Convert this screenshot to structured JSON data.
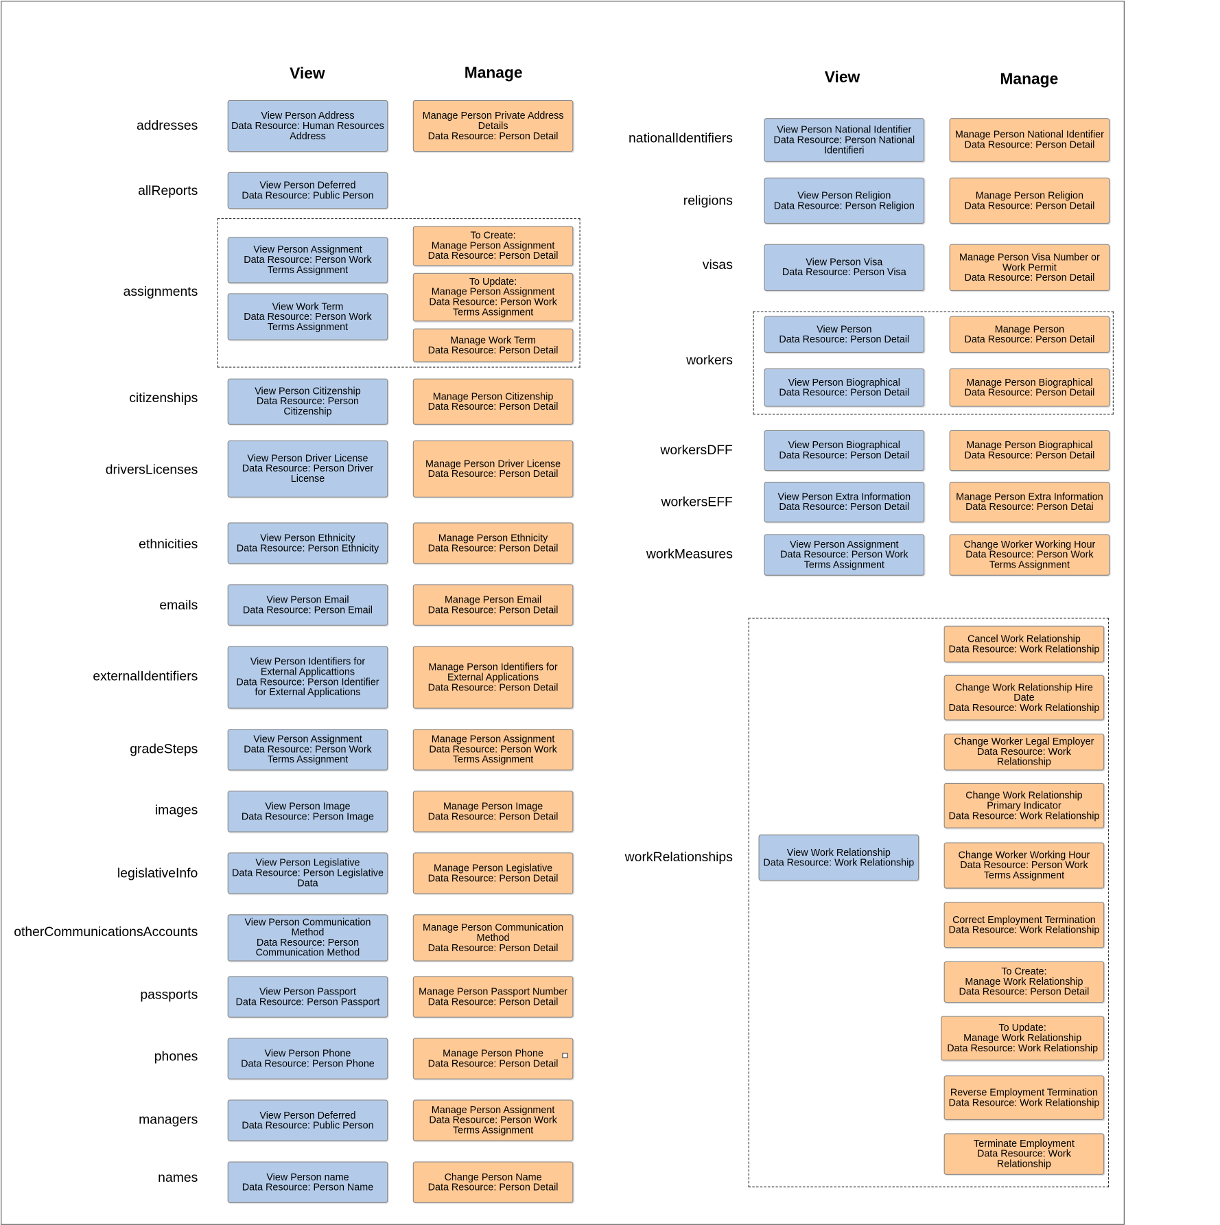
{
  "colors": {
    "view_box": "#b3cbe9",
    "manage_box": "#ffc995",
    "border": "#8a8a8a"
  },
  "left_headers": {
    "view": "View",
    "manage": "Manage"
  },
  "right_headers": {
    "view": "View",
    "manage": "Manage"
  },
  "left_rows": [
    {
      "label": "addresses",
      "view": [
        "View Person Address\nData Resource: Human Resources\nAddress"
      ],
      "manage": [
        "Manage Person Private Address\nDetails\nData Resource: Person Detail"
      ]
    },
    {
      "label": "allReports",
      "view": [
        "View Person Deferred\nData Resource: Public Person"
      ],
      "manage": []
    },
    {
      "label": "assignments",
      "view": [
        "View Person Assignment\nData Resource: Person Work\nTerms Assignment",
        "View Work Term\nData Resource: Person Work\nTerms Assignment"
      ],
      "manage": [
        "To Create:\nManage Person Assignment\nData Resource: Person Detail",
        "To Update:\nManage Person Assignment\nData Resource: Person Work\nTerms Assignment",
        "Manage Work Term\nData Resource: Person Detail"
      ]
    },
    {
      "label": "citizenships",
      "view": [
        "View Person Citizenship\nData Resource: Person\nCitizenship"
      ],
      "manage": [
        "Manage Person Citizenship\nData Resource: Person Detail"
      ]
    },
    {
      "label": "driversLicenses",
      "view": [
        "View Person Driver License\nData Resource: Person Driver\nLicense"
      ],
      "manage": [
        "Manage Person Driver License\nData Resource: Person Detail"
      ]
    },
    {
      "label": "ethnicities",
      "view": [
        "View Person Ethnicity\nData Resource: Person Ethnicity"
      ],
      "manage": [
        "Manage Person Ethnicity\nData Resource: Person Detail"
      ]
    },
    {
      "label": "emails",
      "view": [
        "View Person Email\nData Resource: Person Email"
      ],
      "manage": [
        "Manage Person Email\nData Resource: Person Detail"
      ]
    },
    {
      "label": "externalIdentifiers",
      "view": [
        "View Person Identifiers for\nExternal Applicattions\nData Resource: Person Identifier\nfor External Applications"
      ],
      "manage": [
        "Manage Person Identifiers for\nExternal Applications\nData Resource: Person Detail"
      ]
    },
    {
      "label": "gradeSteps",
      "view": [
        "View Person Assignment\nData Resource: Person Work\nTerms Assignment"
      ],
      "manage": [
        "Manage Person Assignment\nData Resource:  Person Work\nTerms Assignment"
      ]
    },
    {
      "label": "images",
      "view": [
        "View Person Image\nData Resource: Person Image"
      ],
      "manage": [
        "Manage Person Image\nData Resource: Person Detail"
      ]
    },
    {
      "label": "legislativeInfo",
      "view": [
        "View Person Legislative\nData Resource: Person Legislative\nData"
      ],
      "manage": [
        "Manage Person Legislative\nData Resource: Person Detail"
      ]
    },
    {
      "label": "otherCommunicationsAccounts",
      "view": [
        "View Person Communication\nMethod\nData Resource: Person\nCommunication Method"
      ],
      "manage": [
        "Manage Person Communication\nMethod\nData Resource: Person Detail"
      ]
    },
    {
      "label": "passports",
      "view": [
        "View Person Passport\nData Resource: Person Passport"
      ],
      "manage": [
        "Manage Person Passport Number\nData Resource: Person Detail"
      ]
    },
    {
      "label": "phones",
      "view": [
        "View Person Phone\nData Resource: Person Phone"
      ],
      "manage": [
        "Manage Person Phone\nData Resource: Person Detail"
      ]
    },
    {
      "label": "managers",
      "view": [
        "View Person Deferred\nData Resource: Public Person"
      ],
      "manage": [
        "Manage Person Assignment\nData Resource: Person Work\nTerms Assignment"
      ]
    },
    {
      "label": "names",
      "view": [
        "View Person name\nData Resource: Person Name"
      ],
      "manage": [
        "Change Person Name\nData Resource: Person Detail"
      ]
    }
  ],
  "right_rows": [
    {
      "label": "nationalIdentifiers",
      "view": [
        "View Person National Identifier\nData Resource: Person National\nIdentifieri"
      ],
      "manage": [
        "Manage Person National Identifier\nData Resource: Person Detail"
      ]
    },
    {
      "label": "religions",
      "view": [
        "View Person Religion\nData Resource: Person Religion"
      ],
      "manage": [
        "Manage Person Religion\nData Resource: Person Detail"
      ]
    },
    {
      "label": "visas",
      "view": [
        "View Person Visa\nData Resource: Person Visa"
      ],
      "manage": [
        "Manage Person Visa Number or\nWork Permit\nData Resource: Person Detail"
      ]
    },
    {
      "label": "workers",
      "view": [
        "View Person\nData Resource: Person Detail",
        "View Person Biographical\nData Resource: Person Detail"
      ],
      "manage": [
        "Manage Person\nData Resource: Person Detail",
        "Manage Person Biographical\nData Resource: Person Detail"
      ]
    },
    {
      "label": "workersDFF",
      "view": [
        "View Person Biographical\nData Resource: Person Detail"
      ],
      "manage": [
        "Manage Person Biographical\nData Resource: Person Detail"
      ]
    },
    {
      "label": "workersEFF",
      "view": [
        "View Person Extra Information\nData Resource: Person Detail"
      ],
      "manage": [
        "Manage Person Extra Information\nData Resource: Person Detai"
      ]
    },
    {
      "label": "workMeasures",
      "view": [
        "View Person Assignment\nData Resource: Person Work\nTerms Assignment"
      ],
      "manage": [
        "Change Worker Working Hour\nData Resource: Person Work\nTerms Assignment"
      ]
    },
    {
      "label": "workRelationships",
      "view": [
        "View Work Relationship\nData Resource: Work Relationship"
      ],
      "manage": [
        "Cancel Work Relationship\nData Resource: Work Relationship",
        "Change Work Relationship Hire\nDate\nData Resource: Work Relationship",
        "Change Worker Legal Employer\nData Resource: Work\nRelationship",
        "Change Work Relationship\nPrimary  Indicator\nData Resource: Work Relationship",
        "Change Worker Working Hour\nData Resource: Person Work\nTerms Assignment",
        "Correct Employment Termination\nData Resource: Work Relationship",
        "To Create:\nManage Work Relationship\nData Resource: Person Detail",
        "To Update:\nManage Work Relationship\nData Resource: Work Relationship",
        "Reverse Employment Termination\nData Resource: Work Relationship",
        "Terminate Employment\nData Resource: Work\nRelationship"
      ]
    }
  ]
}
